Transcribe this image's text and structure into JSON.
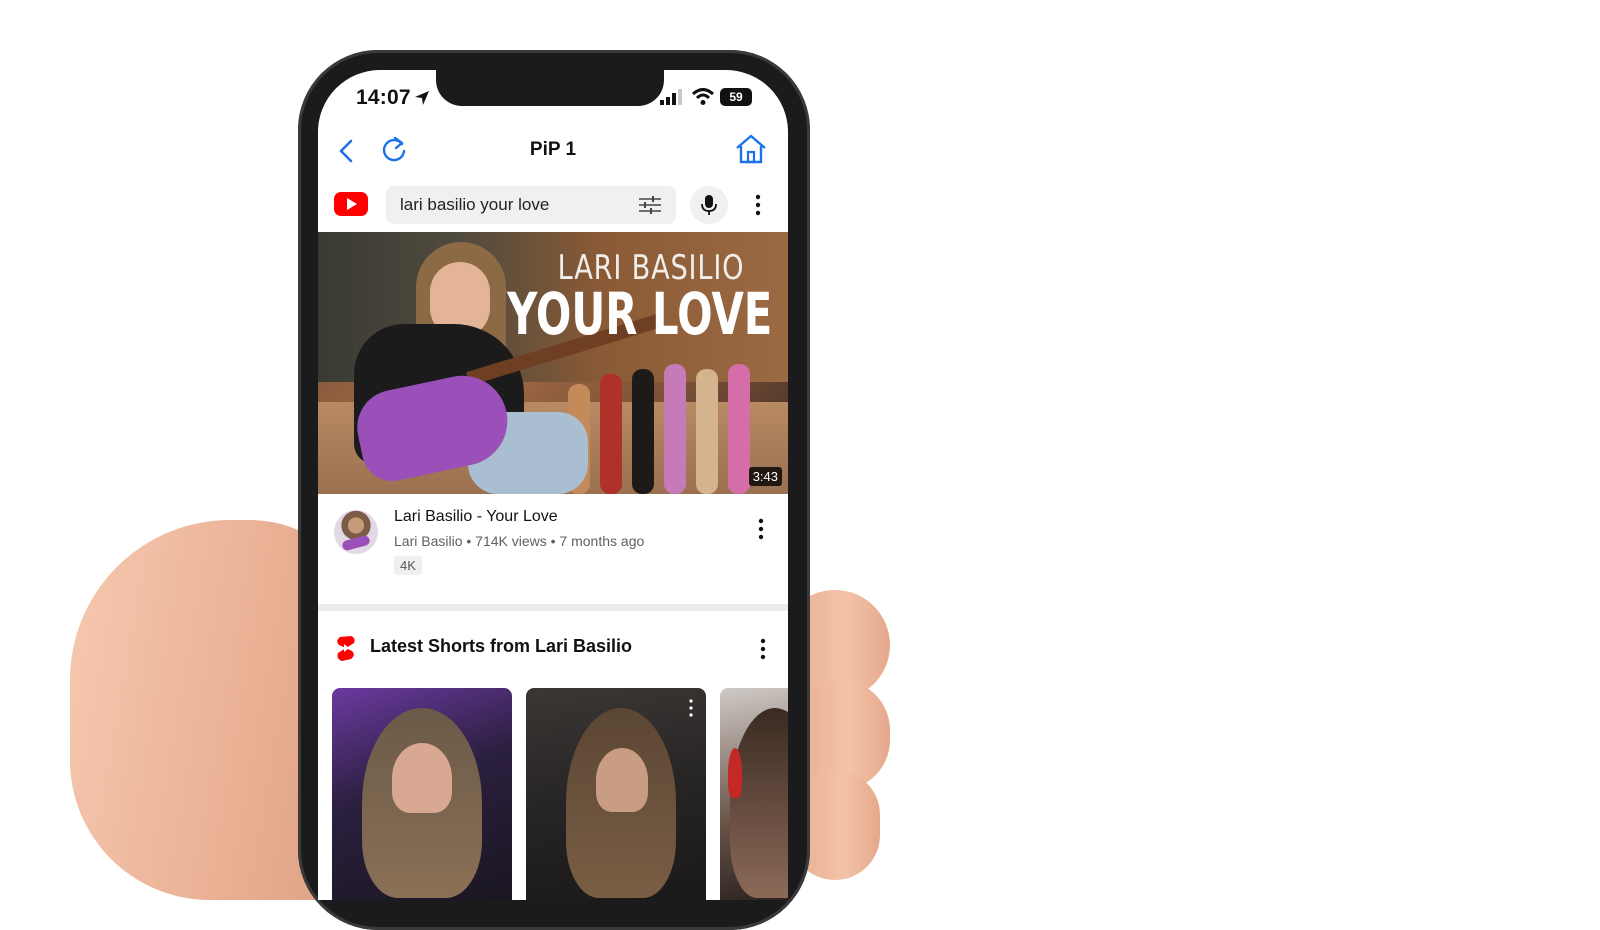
{
  "status_bar": {
    "time": "14:07",
    "battery": "59"
  },
  "nav": {
    "title": "PiP 1"
  },
  "search": {
    "query": "lari basilio your love"
  },
  "video": {
    "thumbnail_line1": "LARI BASILIO",
    "thumbnail_line2": "YOUR LOVE",
    "duration": "3:43",
    "title": "Lari Basilio - Your Love",
    "meta": "Lari Basilio • 714K views • 7 months ago",
    "badge": "4K"
  },
  "shorts": {
    "heading": "Latest Shorts from Lari Basilio"
  },
  "colors": {
    "accent_blue": "#1a73e8",
    "youtube_red": "#ff0000"
  }
}
